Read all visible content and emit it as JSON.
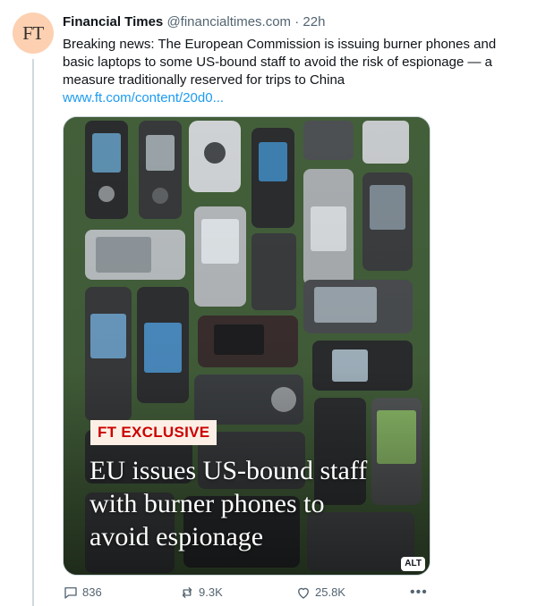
{
  "author": {
    "avatar_text": "FT",
    "name": "Financial Times",
    "handle": "@financialtimes.com",
    "separator": "·",
    "time": "22h"
  },
  "post": {
    "text": "Breaking news: The European Commission is issuing burner phones and basic laptops to some US-bound staff to avoid the risk of espionage — a measure traditionally reserved for trips to China",
    "link": "www.ft.com/content/20d0..."
  },
  "media": {
    "label": "FT EXCLUSIVE",
    "headline_lines": [
      "EU issues US-bound staff",
      "with burner phones to",
      "avoid espionage"
    ],
    "alt_badge": "ALT"
  },
  "actions": {
    "replies": "836",
    "reposts": "9.3K",
    "likes": "25.8K",
    "more": "•••"
  },
  "colors": {
    "link": "#1d9bf0",
    "secondary_text": "#536471",
    "exclusive_red": "#cc0000",
    "avatar_bg": "#fcd0b1"
  }
}
